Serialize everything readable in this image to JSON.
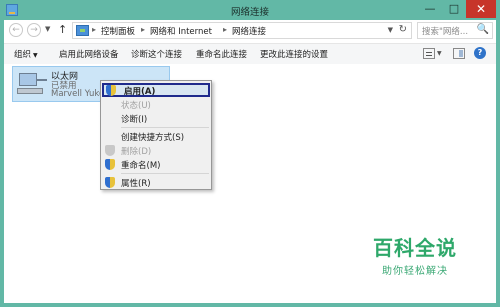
{
  "window": {
    "title": "网络连接",
    "controls": {
      "minimize": "—",
      "maximize": "□",
      "close": "✕"
    }
  },
  "address_bar": {
    "back": "←",
    "forward": "→",
    "up": "↑",
    "breadcrumbs": [
      "控制面板",
      "网络和 Internet",
      "网络连接"
    ],
    "separator": "▸",
    "search_placeholder": "搜索\"网络...",
    "search_icon": "🔍"
  },
  "toolbar": {
    "organize": "组织",
    "items": [
      "启用此网络设备",
      "诊断这个连接",
      "重命名此连接",
      "更改此连接的设置"
    ],
    "help": "?"
  },
  "network_item": {
    "name": "以太网",
    "status": "已禁用",
    "adapter": "Marvell Yukon"
  },
  "context_menu": {
    "items": [
      {
        "label": "启用(A)",
        "icon": "shield-icon",
        "disabled": false,
        "highlight": true
      },
      {
        "label": "状态(U)",
        "icon": null,
        "disabled": true
      },
      {
        "label": "诊断(I)",
        "icon": null,
        "disabled": false
      },
      {
        "label": "创建快捷方式(S)",
        "icon": null,
        "disabled": false
      },
      {
        "label": "删除(D)",
        "icon": "shield-icon",
        "disabled": true
      },
      {
        "label": "重命名(M)",
        "icon": "shield-icon",
        "disabled": false
      },
      {
        "label": "属性(R)",
        "icon": "shield-icon",
        "disabled": false
      }
    ]
  },
  "watermark": {
    "main": "百科全说",
    "sub": "助你轻松解决"
  },
  "colors": {
    "frame": "#62b8a6",
    "close_button": "#c7352a",
    "selection": "#cce5f7",
    "menu_highlight_border": "#1f2a8c",
    "watermark": "#2ea86a"
  }
}
